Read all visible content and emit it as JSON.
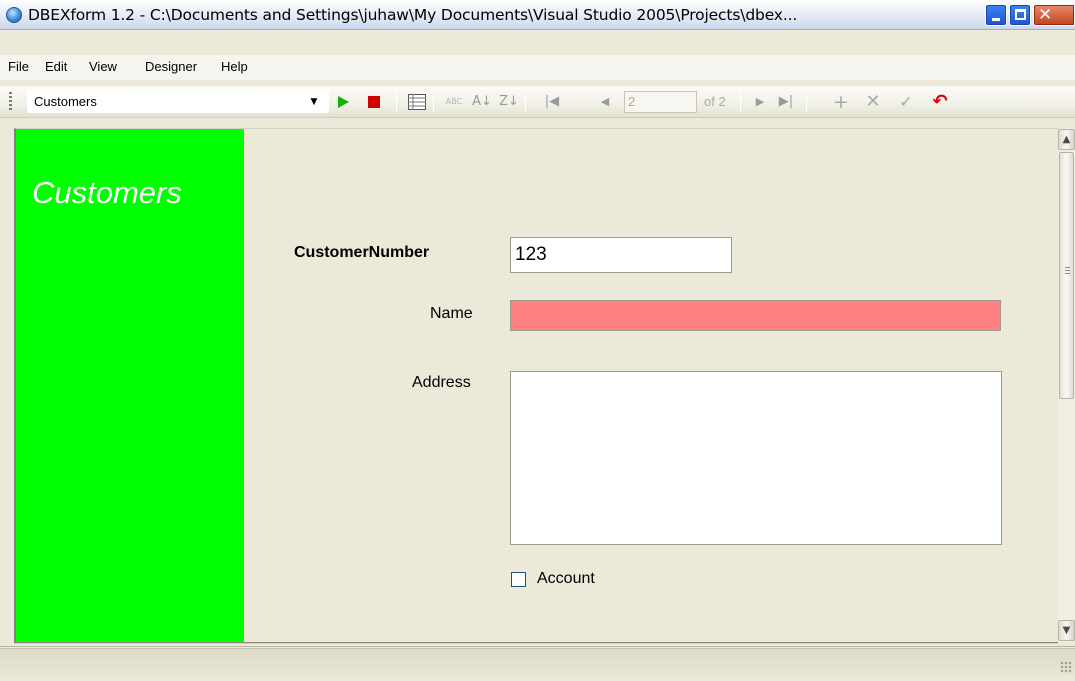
{
  "window": {
    "title": "DBEXform 1.2 - C:\\Documents and Settings\\juhaw\\My Documents\\Visual Studio 2005\\Projects\\dbex..."
  },
  "menu": {
    "items": [
      "File",
      "Edit",
      "View",
      "Designer",
      "Help"
    ]
  },
  "toolbar": {
    "table_select": "Customers",
    "record_position": "2",
    "record_count_label": "of 2",
    "icons": [
      "play-icon",
      "stop-icon",
      "grid-view-icon",
      "spellcheck-icon",
      "sort-ascending-icon",
      "sort-descending-icon",
      "first-record-icon",
      "previous-record-icon",
      "next-record-icon",
      "last-record-icon",
      "add-record-icon",
      "delete-record-icon",
      "save-record-icon",
      "undo-icon"
    ]
  },
  "form": {
    "panel_title": "Customers",
    "panel_color": "#00ff00",
    "fields": {
      "customer_number_label": "CustomerNumber",
      "customer_number_value": "123",
      "name_label": "Name",
      "name_value": "",
      "name_field_color": "#ff8080",
      "address_label": "Address",
      "address_value": ""
    },
    "account_checkbox": {
      "label": "Account",
      "checked": false
    }
  }
}
